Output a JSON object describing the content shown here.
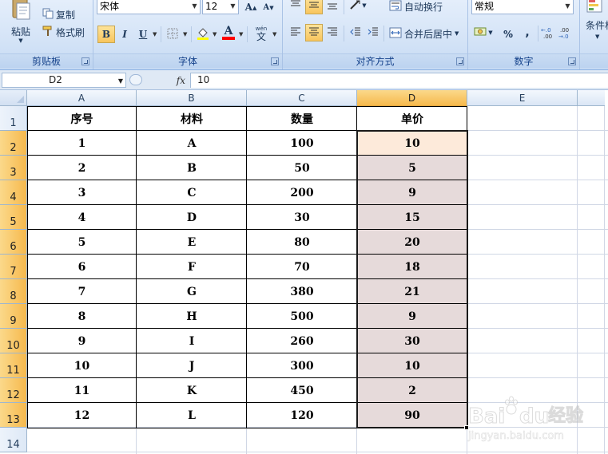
{
  "ribbon": {
    "clipboard": {
      "caption": "剪贴板",
      "paste_label": "粘贴",
      "copy_label": "复制",
      "format_painter_label": "格式刷"
    },
    "font": {
      "caption": "字体",
      "font_name": "宋体",
      "font_size": "12",
      "bold": "B",
      "italic": "I",
      "underline": "U",
      "font_color_glyph": "A",
      "phonetic_top": "wén",
      "phonetic_char": "文"
    },
    "alignment": {
      "caption": "对齐方式",
      "wrap_text_label": "自动换行",
      "merge_center_label": "合并后居中"
    },
    "number": {
      "caption": "数字",
      "format_value": "常规",
      "percent": "%",
      "comma": ",",
      "increase_decimal": "+.0 .00",
      "decrease_decimal": ".00 →.0"
    },
    "styles": {
      "conditional_label": "条件格"
    }
  },
  "formula_bar": {
    "name_box": "D2",
    "fx": "fx",
    "content": "10"
  },
  "sheet": {
    "columns": [
      "A",
      "B",
      "C",
      "D",
      "E"
    ],
    "rows": [
      "1",
      "2",
      "3",
      "4",
      "5",
      "6",
      "7",
      "8",
      "9",
      "10",
      "11",
      "12",
      "13",
      "14"
    ],
    "active_column": "D",
    "header": [
      "序号",
      "材料",
      "数量",
      "单价"
    ],
    "data": [
      [
        "1",
        "A",
        "100",
        "10"
      ],
      [
        "2",
        "B",
        "50",
        "5"
      ],
      [
        "3",
        "C",
        "200",
        "9"
      ],
      [
        "4",
        "D",
        "30",
        "15"
      ],
      [
        "5",
        "E",
        "80",
        "20"
      ],
      [
        "6",
        "F",
        "70",
        "18"
      ],
      [
        "7",
        "G",
        "380",
        "21"
      ],
      [
        "8",
        "H",
        "500",
        "9"
      ],
      [
        "9",
        "I",
        "260",
        "30"
      ],
      [
        "10",
        "J",
        "300",
        "10"
      ],
      [
        "11",
        "K",
        "450",
        "2"
      ],
      [
        "12",
        "L",
        "120",
        "90"
      ]
    ]
  },
  "watermark": {
    "brand": "Bai",
    "brand_suffix": "du",
    "product": "经验",
    "url": "jingyan.baidu.com"
  },
  "colors": {
    "selection_fill": "#e6dada",
    "active_cell_fill": "#fdeada",
    "header_highlight": "#f6b94d"
  }
}
